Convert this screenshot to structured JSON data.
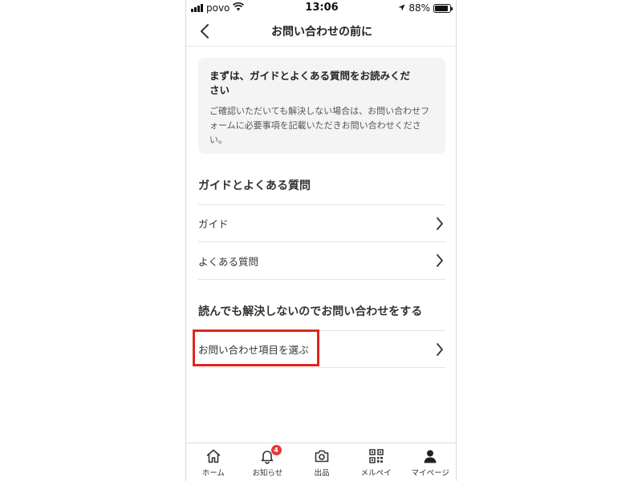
{
  "status_bar": {
    "carrier": "povo",
    "time": "13:06",
    "battery_percent": "88%",
    "battery_level": 0.88,
    "icons": [
      "signal-icon",
      "wifi-icon",
      "location-arrow-icon",
      "battery-icon"
    ]
  },
  "header": {
    "title": "お問い合わせの前に",
    "back_icon": "chevron-left-icon"
  },
  "info_box": {
    "heading": "まずは、ガイドとよくある質問をお読みください",
    "body": "ご確認いただいても解決しない場合は、お問い合わせフォームに必要事項を記載いただきお問い合わせください。"
  },
  "guide_section": {
    "title": "ガイドとよくある質問",
    "items": [
      {
        "label": "ガイド",
        "icon": "chevron-right-icon"
      },
      {
        "label": "よくある質問",
        "icon": "chevron-right-icon"
      }
    ]
  },
  "contact_section": {
    "title": "読んでも解決しないのでお問い合わせをする",
    "items": [
      {
        "label": "お問い合わせ項目を選ぶ",
        "icon": "chevron-right-icon",
        "highlighted": true
      }
    ]
  },
  "highlight_color": "#e0261c",
  "tab_bar": {
    "tabs": [
      {
        "label": "ホーム",
        "icon": "home-icon"
      },
      {
        "label": "お知らせ",
        "icon": "bell-icon",
        "badge": "4"
      },
      {
        "label": "出品",
        "icon": "camera-icon"
      },
      {
        "label": "メルペイ",
        "icon": "qr-code-icon"
      },
      {
        "label": "マイページ",
        "icon": "person-icon"
      }
    ]
  }
}
